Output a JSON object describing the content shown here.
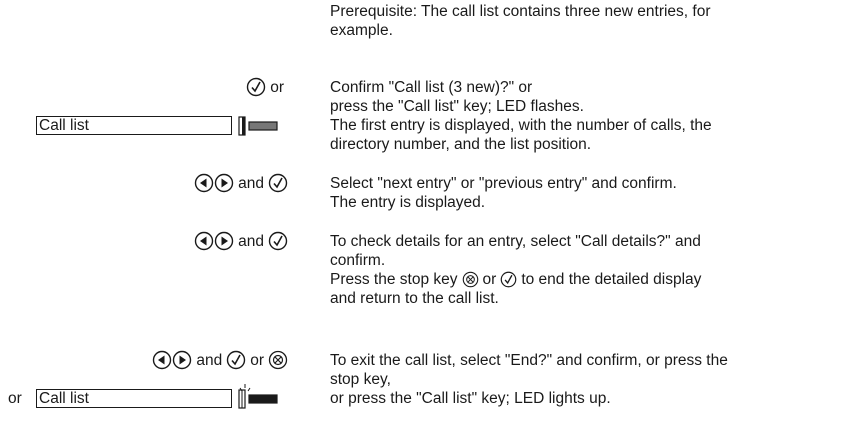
{
  "prereq": [
    "Prerequisite: The call list contains three new entries, for",
    "example."
  ],
  "step1": {
    "left": "or",
    "icons": [
      "confirm-icon"
    ],
    "lines": [
      "Confirm \"Call list (3 new)?\" or",
      "press the \"Call list\" key; LED flashes.",
      "The first entry is displayed, with the number of calls, the",
      "directory number, and the list position."
    ],
    "key_label": "Call list"
  },
  "step2": {
    "left": "and",
    "lines": [
      "Select \"next entry\" or \"previous entry\" and confirm.",
      "The entry is displayed."
    ]
  },
  "step3": {
    "left": "and",
    "lines": [
      "To check details for an entry, select \"Call details?\" and",
      "confirm."
    ],
    "line3a": "Press the stop key",
    "line3b": "or",
    "line3c": "to end the detailed display",
    "line4": "and return to the call list."
  },
  "step4": {
    "left_and": "and",
    "left_or": "or",
    "lines": [
      "To exit the call list, select \"End?\" and confirm, or press the",
      "stop key,",
      "or press the \"Call list\" key; LED lights up."
    ],
    "prefix": "or",
    "key_label": "Call list"
  },
  "icons": {
    "confirm": "check-circle",
    "left": "left-arrow-circle",
    "right": "right-arrow-circle",
    "stop": "stop-circle",
    "led_off": "led-off",
    "led_on": "led-lit"
  }
}
